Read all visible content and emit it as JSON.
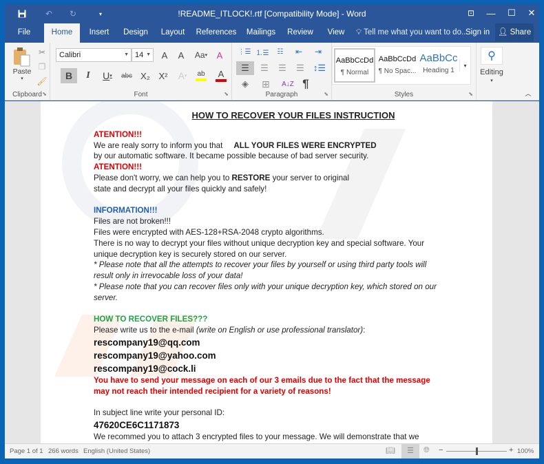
{
  "window": {
    "title": "!README_ITLOCK!.rtf [Compatibility Mode] - Word",
    "qat": {
      "save_icon": "save-icon",
      "undo_icon": "undo-icon",
      "redo_icon": "redo-icon",
      "customize_icon": "customize-qat-icon"
    },
    "controls": {
      "ribbon_display": "⊡",
      "minimize": "—",
      "maximize": "☐",
      "close": "✕"
    }
  },
  "tabs": [
    {
      "label": "File"
    },
    {
      "label": "Home",
      "active": true
    },
    {
      "label": "Insert"
    },
    {
      "label": "Design"
    },
    {
      "label": "Layout"
    },
    {
      "label": "References"
    },
    {
      "label": "Mailings"
    },
    {
      "label": "Review"
    },
    {
      "label": "View"
    }
  ],
  "tellme": {
    "placeholder": "Tell me what you want to do..."
  },
  "account": {
    "signin": "Sign in",
    "share": "Share"
  },
  "ribbon": {
    "clipboard": {
      "label": "Clipboard",
      "paste": "Paste"
    },
    "font": {
      "label": "Font",
      "font_name": "Calibri",
      "font_size": "14",
      "grow": "A",
      "shrink": "A",
      "change_case": "Aa",
      "bold": "B",
      "italic": "I",
      "underline": "U",
      "strikethrough": "abc",
      "subscript": "X₂",
      "superscript": "X²",
      "text_effects": "A",
      "highlight": "ab",
      "font_color": "A",
      "highlight_color": "#ffff00",
      "font_color_value": "#e00000"
    },
    "paragraph": {
      "label": "Paragraph",
      "pilcrow": "¶",
      "sort": "A↓Z"
    },
    "styles": {
      "label": "Styles",
      "items": [
        {
          "sample": "AaBbCcDd",
          "name": "¶ Normal",
          "selected": true
        },
        {
          "sample": "AaBbCcDd",
          "name": "¶ No Spac..."
        },
        {
          "sample": "AaBbCc",
          "name": "Heading 1"
        }
      ]
    },
    "editing": {
      "label": "Editing"
    }
  },
  "document": {
    "heading": "HOW TO RECOVER YOUR FILES INSTRUCTION",
    "attention1": "ATENTION!!!",
    "line1a": "We are realy sorry to inform you that",
    "line1b": "ALL YOUR FILES WERE ENCRYPTED",
    "line2": "by our automatic software. It became possible because of bad server security.",
    "attention2": "ATENTION!!!",
    "line3a": "Please don't worry, we can help you to ",
    "line3b": "RESTORE",
    "line3c": " your server to original",
    "line4": "state and decrypt all your files quickly and safely!",
    "info_heading": "INFORMATION!!!",
    "info1": "Files are not broken!!!",
    "info2": "Files were encrypted with AES-128+RSA-2048 crypto algorithms.",
    "info3": "There is no way to decrypt your files without unique decryption key and special software. Your unique decryption key is securely stored on our server.",
    "note1": "* Please note that all the attempts to recover your files by yourself or using third party tools will result only in irrevocable loss of your data!",
    "note2": "* Please note that you can recover files only with your unique decryption key, which stored on our server.",
    "recover_heading": "HOW TO RECOVER FILES???",
    "write_a": "Please write us to the e-mail ",
    "write_b": "(write on English or use professional translator)",
    "write_c": ":",
    "emails": [
      "rescompany19@qq.com",
      "rescompany19@yahoo.com",
      "rescompany19@cock.li"
    ],
    "warning": "You have to send your message on each of our 3 emails due to the fact that the message may not reach their intended recipient for a variety of reasons!",
    "subject_line": "In subject line write your personal ID:",
    "personal_id": "47620CE6C1171873",
    "attach_line": "We recommed you to attach 3 encrypted files to your message. We will demonstrate that we"
  },
  "statusbar": {
    "page": "Page 1 of 1",
    "words": "266 words",
    "language": "English (United States)",
    "zoom_minus": "−",
    "zoom_plus": "+",
    "zoom_level": "100%",
    "zoom_fraction": 0.5
  },
  "colors": {
    "word_blue": "#2b579a",
    "attention_red": "#e00000",
    "info_blue": "#1f5fb5",
    "recover_green": "#1fa34a"
  }
}
